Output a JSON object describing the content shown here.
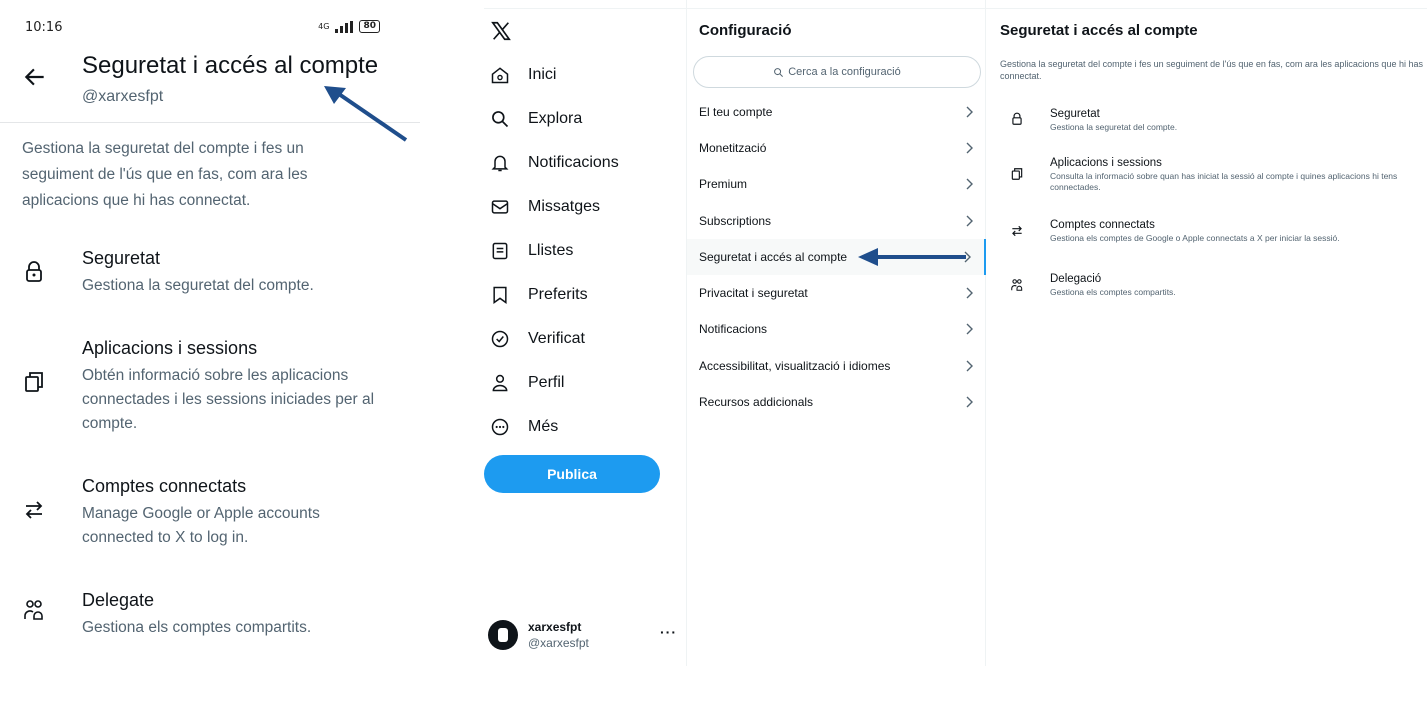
{
  "mobile": {
    "status": {
      "time": "10:16",
      "network": "4G",
      "battery": "80"
    },
    "title": "Seguretat i accés al compte",
    "handle": "@xarxesfpt",
    "description": "Gestiona la seguretat del compte i fes un seguiment de l'ús que en fas, com ara les aplicacions que hi has connectat.",
    "items": [
      {
        "label": "Seguretat",
        "sub": "Gestiona la seguretat del compte.",
        "icon": "lock-icon"
      },
      {
        "label": "Aplicacions i sessions",
        "sub": "Obtén informació sobre les aplicacions connectades i les sessions iniciades per al compte.",
        "icon": "copy-icon"
      },
      {
        "label": "Comptes connectats",
        "sub": "Manage Google or Apple accounts connected to X to log in.",
        "icon": "swap-arrows-icon"
      },
      {
        "label": "Delegate",
        "sub": "Gestiona els comptes compartits.",
        "icon": "people-icon"
      }
    ]
  },
  "desktop": {
    "nav": {
      "items": [
        {
          "label": "Inici",
          "icon": "home-icon"
        },
        {
          "label": "Explora",
          "icon": "search-icon"
        },
        {
          "label": "Notificacions",
          "icon": "bell-icon"
        },
        {
          "label": "Missatges",
          "icon": "mail-icon"
        },
        {
          "label": "Llistes",
          "icon": "list-icon"
        },
        {
          "label": "Preferits",
          "icon": "bookmark-icon"
        },
        {
          "label": "Verificat",
          "icon": "verified-icon"
        },
        {
          "label": "Perfil",
          "icon": "person-icon"
        },
        {
          "label": "Més",
          "icon": "more-circle-icon"
        }
      ],
      "post_label": "Publica",
      "account": {
        "name": "xarxesfpt",
        "handle": "@xarxesfpt",
        "more": "···"
      }
    },
    "settings": {
      "title": "Configuració",
      "search_placeholder": "Cerca a la configuració",
      "items": [
        {
          "label": "El teu compte"
        },
        {
          "label": "Monetització"
        },
        {
          "label": "Premium"
        },
        {
          "label": "Subscriptions"
        },
        {
          "label": "Seguretat i accés al compte"
        },
        {
          "label": "Privacitat i seguretat"
        },
        {
          "label": "Notificacions"
        },
        {
          "label": "Accessibilitat, visualització i idiomes"
        },
        {
          "label": "Recursos addicionals"
        }
      ],
      "active_index": 4
    },
    "detail": {
      "title": "Seguretat i accés al compte",
      "description": "Gestiona la seguretat del compte i fes un seguiment de l'ús que en fas, com ara les aplicacions que hi has connectat.",
      "items": [
        {
          "label": "Seguretat",
          "sub": "Gestiona la seguretat del compte.",
          "icon": "lock-icon"
        },
        {
          "label": "Aplicacions i sessions",
          "sub": "Consulta la informació sobre quan has iniciat la sessió al compte i quines aplicacions hi tens connectades.",
          "icon": "copy-icon"
        },
        {
          "label": "Comptes connectats",
          "sub": "Gestiona els comptes de Google o Apple connectats a X per iniciar la sessió.",
          "icon": "swap-arrows-icon"
        },
        {
          "label": "Delegació",
          "sub": "Gestiona els comptes compartits.",
          "icon": "people-icon"
        }
      ]
    }
  },
  "colors": {
    "accent": "#1d9bf0",
    "annotation_arrow": "#1f4e8c",
    "text": "#0f1419",
    "muted": "#536471"
  }
}
